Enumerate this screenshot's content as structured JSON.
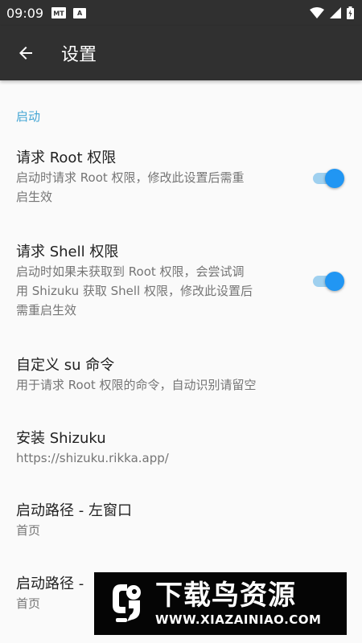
{
  "status_bar": {
    "time": "09:09",
    "notification_badge": "A",
    "icons": [
      "mt-notification-icon",
      "a-notification-icon",
      "wifi-icon",
      "signal-icon",
      "battery-icon"
    ]
  },
  "app_bar": {
    "title": "设置",
    "back_icon": "arrow-back-icon"
  },
  "category": "启动",
  "prefs": [
    {
      "title": "请求 Root 权限",
      "summary_lines": [
        "启动时请求 Root 权限，修改此设置后需重",
        "启生效"
      ],
      "switch_on": true
    },
    {
      "title": "请求 Shell 权限",
      "summary_lines": [
        "启动时如果未获取到 Root 权限，会尝试调",
        "用 Shizuku 获取 Shell 权限，修改此设置后",
        "需重启生效"
      ],
      "switch_on": true
    },
    {
      "title": "自定义 su 命令",
      "summary_lines": [
        "用于请求 Root 权限的命令，自动识别请留空"
      ]
    },
    {
      "title": "安装 Shizuku",
      "summary_lines": [
        "https://shizuku.rikka.app/"
      ]
    },
    {
      "title": "启动路径 - 左窗口",
      "summary_lines": [
        "首页"
      ]
    },
    {
      "title": "启动路径 - ",
      "summary_lines": [
        "首页"
      ]
    }
  ],
  "watermark": {
    "name": "下载鸟资源",
    "url": "WWW.XIAZAINIAO.COM"
  },
  "colors": {
    "app_bar": "#303030",
    "accent": "#2196f3",
    "category": "#42a5d4",
    "background": "#fafafa"
  }
}
